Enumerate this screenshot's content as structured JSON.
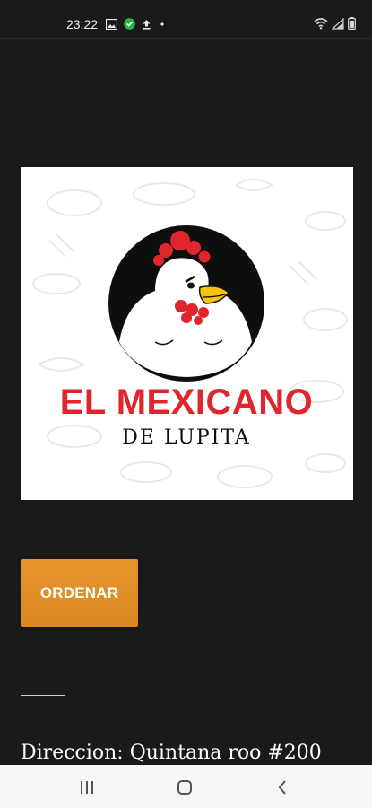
{
  "status_bar": {
    "time": "23:22",
    "left_icons": [
      "gallery-icon",
      "check-badge-icon",
      "upload-icon",
      "dot-icon"
    ],
    "right_icons": [
      "wifi-icon",
      "signal-icon",
      "battery-icon"
    ]
  },
  "logo": {
    "line1": "EL MEXICANO",
    "line2": "DE LUPITA",
    "colors": {
      "red": "#e0262d",
      "black": "#0e0e0e",
      "yellow": "#f5c20d"
    }
  },
  "order_button": {
    "label": "ORDENAR",
    "color": "#e08a24"
  },
  "address": {
    "text": "Direccion: Quintana roo #200"
  },
  "nav_bar": {
    "buttons": [
      "recent-apps-icon",
      "home-icon",
      "back-icon"
    ]
  }
}
